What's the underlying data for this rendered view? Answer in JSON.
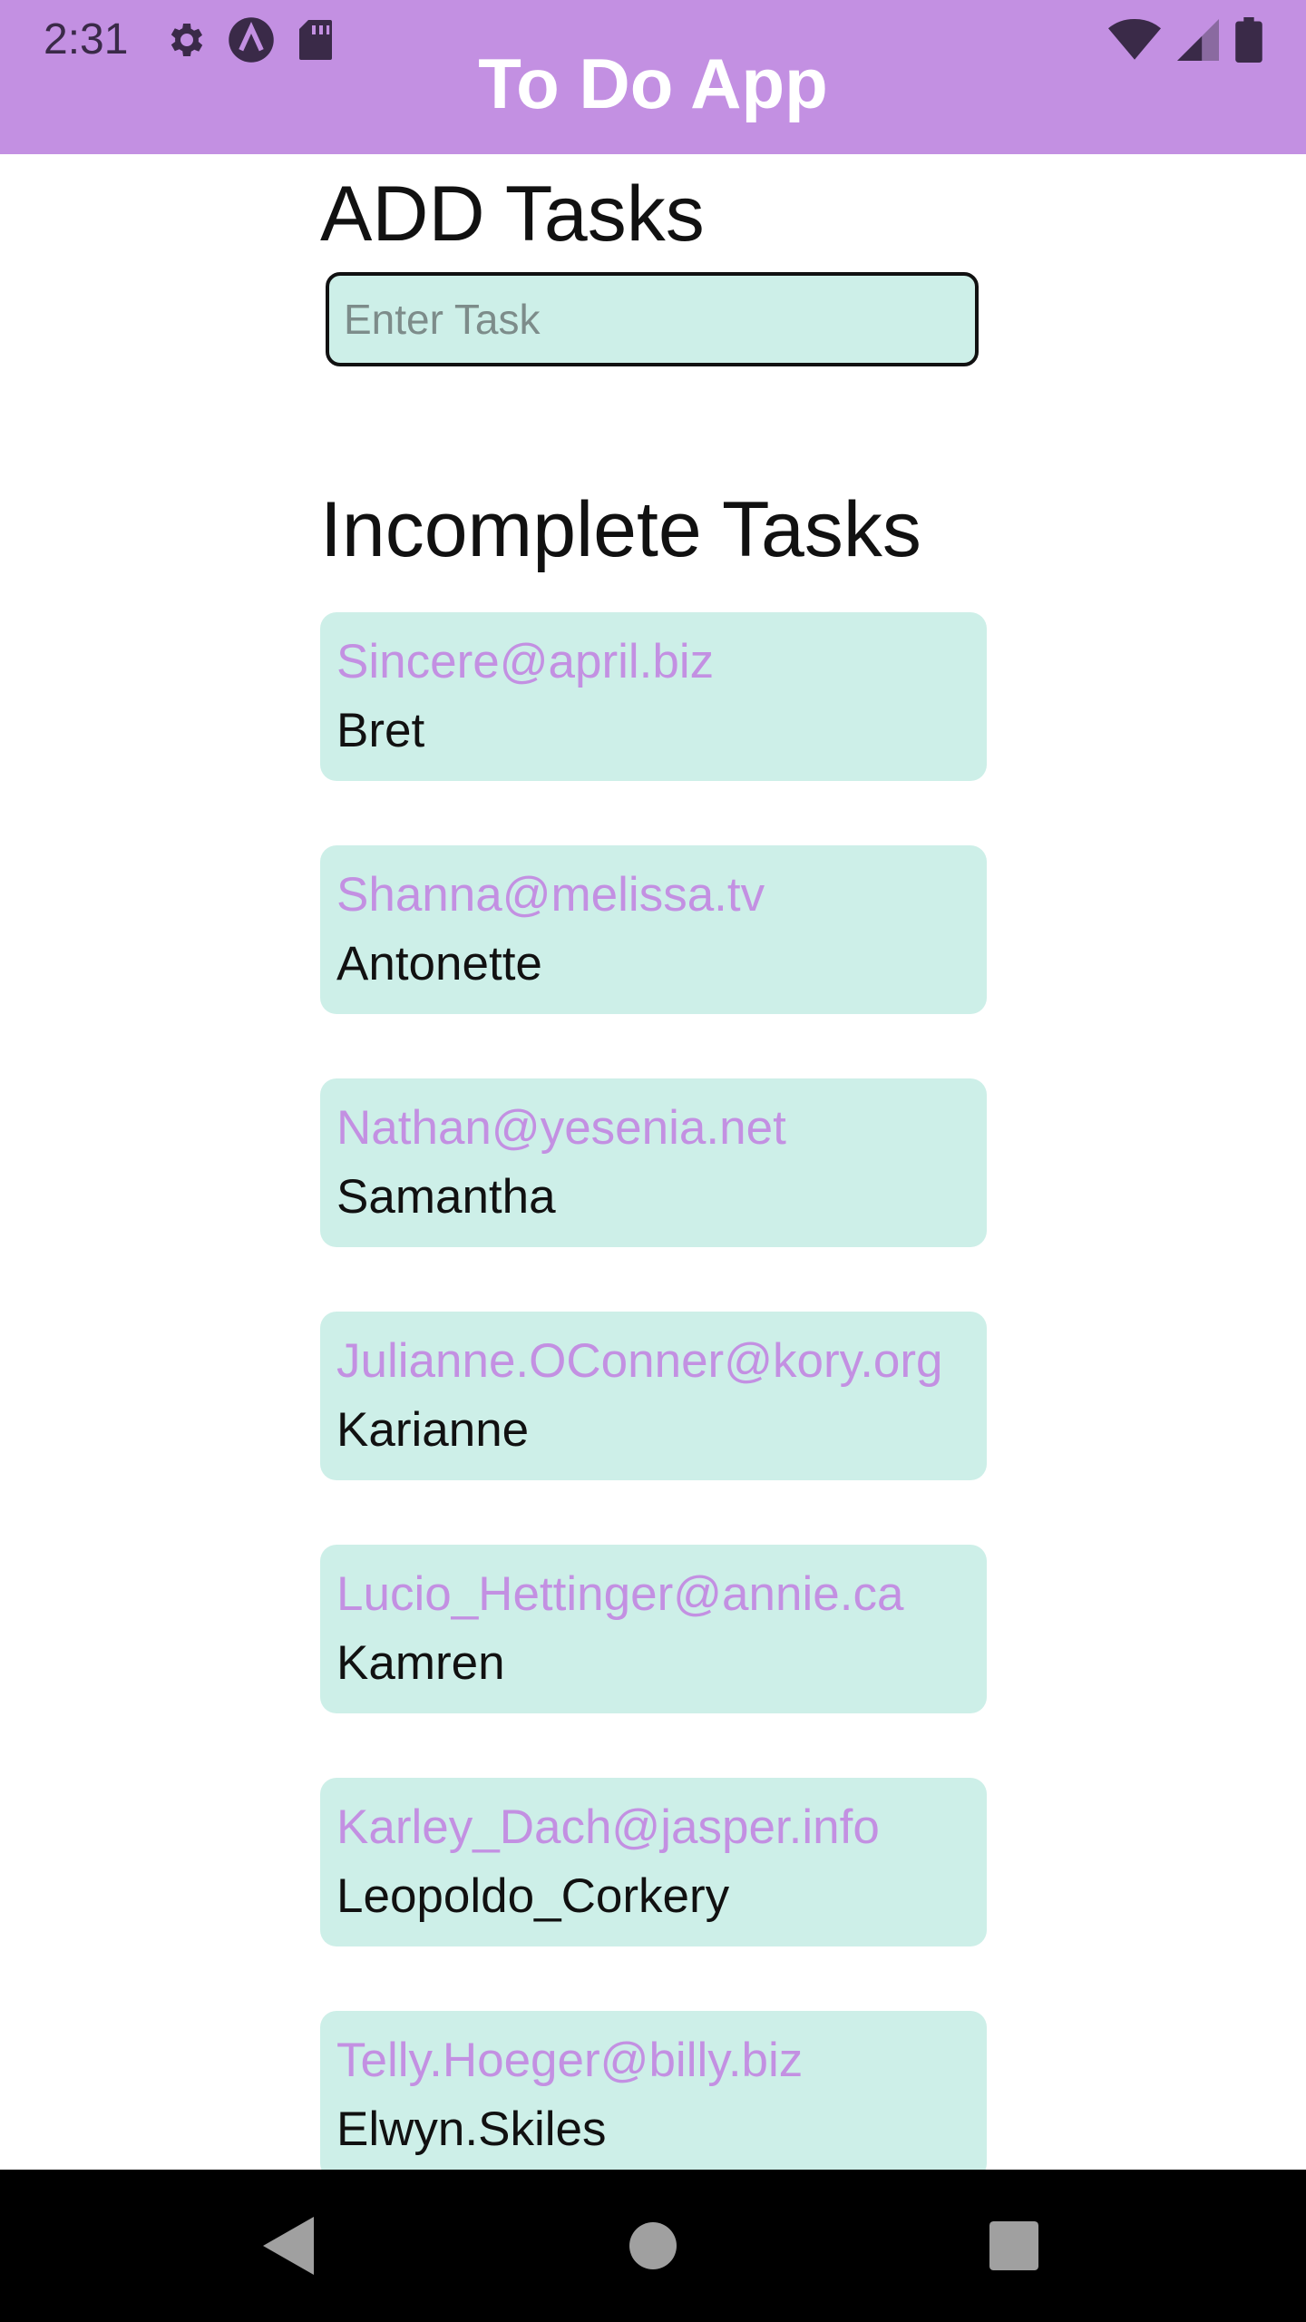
{
  "status_bar": {
    "time": "2:31",
    "left_icons": [
      "gear-icon",
      "a-logo-icon",
      "sd-card-icon"
    ],
    "right_icons": [
      "wifi-icon",
      "signal-icon",
      "battery-icon"
    ]
  },
  "app_bar": {
    "title": "To Do App",
    "color": "#c390e2"
  },
  "add_section": {
    "heading": "ADD Tasks",
    "input_placeholder": "Enter Task",
    "input_value": ""
  },
  "incomplete_section": {
    "heading": "Incomplete Tasks",
    "tasks": [
      {
        "email": "Sincere@april.biz",
        "name": "Bret"
      },
      {
        "email": "Shanna@melissa.tv",
        "name": "Antonette"
      },
      {
        "email": "Nathan@yesenia.net",
        "name": "Samantha"
      },
      {
        "email": "Julianne.OConner@kory.org",
        "name": "Karianne"
      },
      {
        "email": "Lucio_Hettinger@annie.ca",
        "name": "Kamren"
      },
      {
        "email": "Karley_Dach@jasper.info",
        "name": "Leopoldo_Corkery"
      },
      {
        "email": "Telly.Hoeger@billy.biz",
        "name": "Elwyn.Skiles"
      }
    ]
  },
  "colors": {
    "accent": "#c390e2",
    "card_background": "#cdefe8"
  },
  "nav_bar": {
    "buttons": [
      "back-icon",
      "home-icon",
      "recents-icon"
    ]
  }
}
